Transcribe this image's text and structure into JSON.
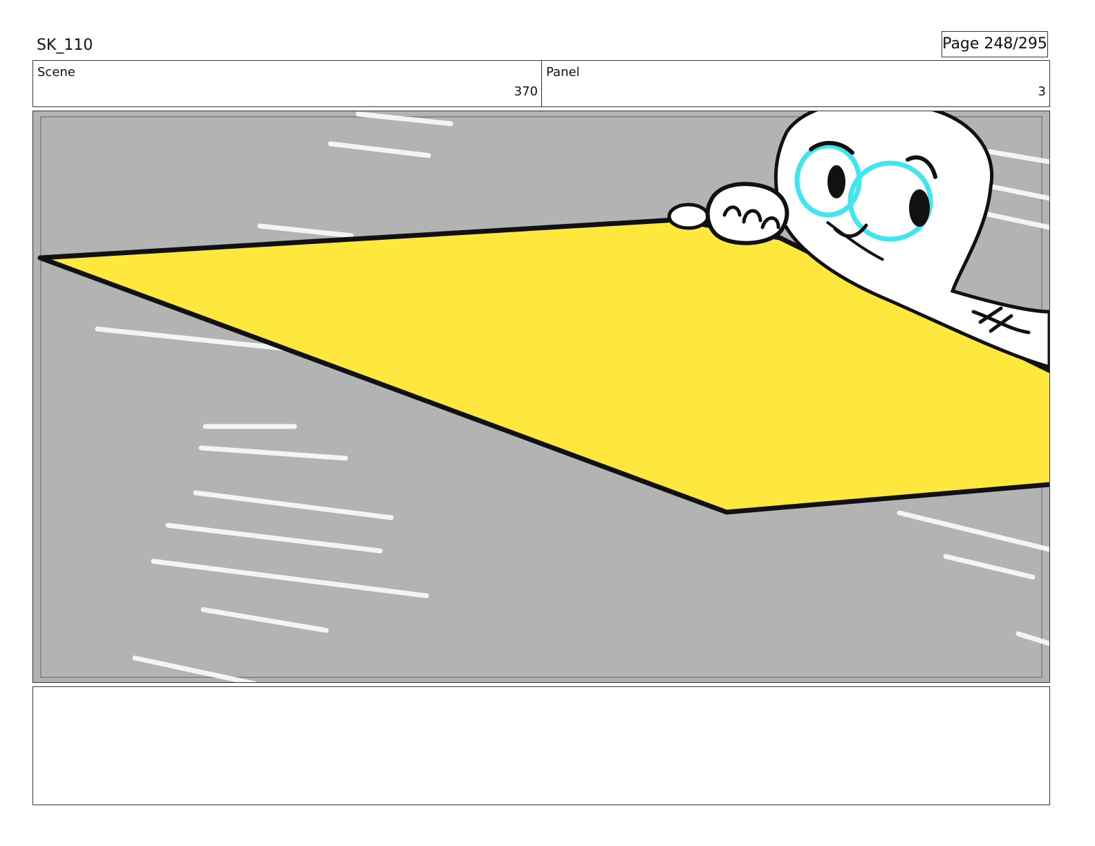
{
  "header": {
    "project_code": "SK_110",
    "page_indicator": "Page 248/295"
  },
  "info": {
    "scene_label": "Scene",
    "scene_number": "370",
    "panel_label": "Panel",
    "panel_number": "3"
  },
  "colors": {
    "road_gray": "#b3b3b3",
    "sign_yellow": "#ffe83d",
    "line_black": "#111111",
    "eye_cyan": "#3fe6f0",
    "stripe_white": "#f4f4f4"
  },
  "notes": {
    "text": ""
  }
}
